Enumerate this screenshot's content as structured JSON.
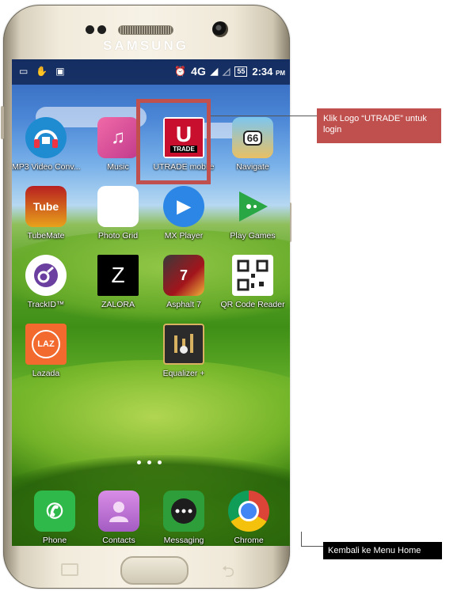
{
  "device": {
    "brand": "SAMSUNG"
  },
  "status_bar": {
    "network": "4G",
    "network_sup": "4G",
    "battery": "55",
    "time": "2:34",
    "ampm": "PM"
  },
  "apps": [
    {
      "label": "MP3 Video Conv...",
      "icon": "headphones-icon",
      "color": "#1f8bd1"
    },
    {
      "label": "Music",
      "icon": "music-note-icon",
      "color": "#e24b9b"
    },
    {
      "label": "UTRADE mobile",
      "icon": "utrade-logo-icon",
      "color": "#c8102e",
      "icon_text": "U",
      "icon_sub": "TRADE"
    },
    {
      "label": "Navigate",
      "icon": "map-navigate-icon",
      "color": "#5cb6e8",
      "icon_text": "66"
    },
    {
      "label": "TubeMate",
      "icon": "tubemate-icon",
      "color": "#b82020",
      "icon_text": "Tube"
    },
    {
      "label": "Photo Grid",
      "icon": "photo-grid-icon",
      "color": "#f6c81d"
    },
    {
      "label": "MX Player",
      "icon": "play-icon",
      "color": "#2b86e6"
    },
    {
      "label": "Play Games",
      "icon": "gamepad-icon",
      "color": "#29a744"
    },
    {
      "label": "TrackID™",
      "icon": "trackid-icon",
      "color": "#6b3fa0"
    },
    {
      "label": "ZALORA",
      "icon": "zalora-logo-icon",
      "color": "#000000",
      "icon_text": "Z"
    },
    {
      "label": "Asphalt 7",
      "icon": "race-car-icon",
      "color": "#a3141c"
    },
    {
      "label": "QR Code Reader",
      "icon": "qr-code-icon",
      "color": "#ffffff"
    },
    {
      "label": "Lazada",
      "icon": "lazada-logo-icon",
      "color": "#f26a2e",
      "icon_text": "LAZ"
    },
    {
      "label": "Equalizer +",
      "icon": "equalizer-icon",
      "color": "#2b2b2b"
    }
  ],
  "dock": [
    {
      "label": "Phone",
      "icon": "phone-icon",
      "color": "#2fb94a"
    },
    {
      "label": "Contacts",
      "icon": "contacts-icon",
      "color": "#c27bd8"
    },
    {
      "label": "Messaging",
      "icon": "messaging-icon",
      "color": "#2e9e3a"
    },
    {
      "label": "Chrome",
      "icon": "chrome-icon",
      "color": "#ffffff"
    }
  ],
  "annotations": {
    "utrade_callout": "Klik Logo “UTRADE” untuk login",
    "home_callout": "Kembali ke Menu Home"
  },
  "colors": {
    "highlight": "#c0504d"
  }
}
